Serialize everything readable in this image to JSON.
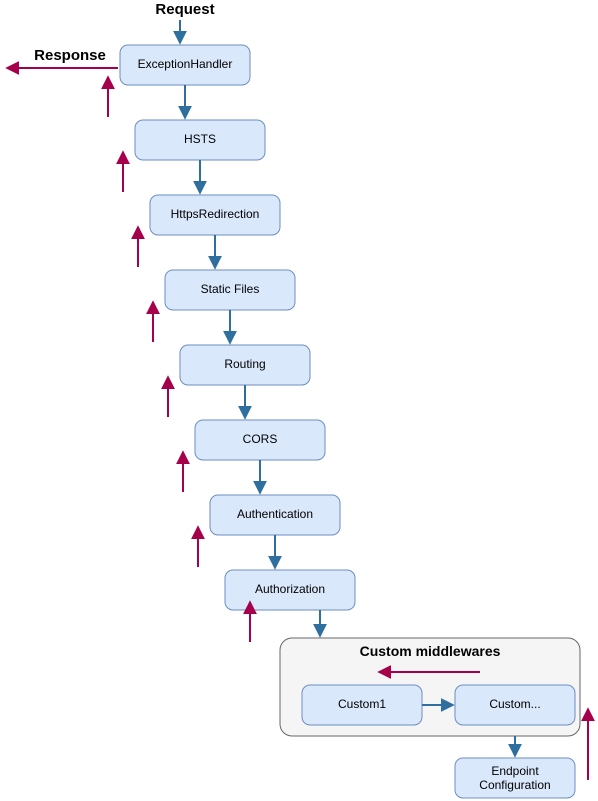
{
  "labels": {
    "request": "Request",
    "response": "Response",
    "custom_group": "Custom middlewares"
  },
  "nodes": {
    "n0": "ExceptionHandler",
    "n1": "HSTS",
    "n2": "HttpsRedirection",
    "n3": "Static Files",
    "n4": "Routing",
    "n5": "CORS",
    "n6": "Authentication",
    "n7": "Authorization",
    "c1": "Custom1",
    "c2": "Custom...",
    "endpoint": "Endpoint\nConfiguration"
  }
}
